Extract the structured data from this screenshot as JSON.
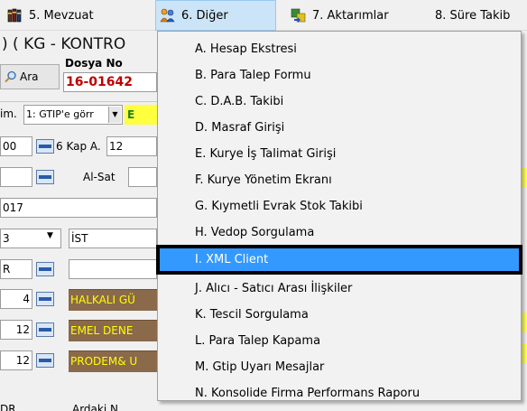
{
  "menubar": {
    "items": [
      {
        "label": "5. Mevzuat"
      },
      {
        "label": "6. Diğer"
      },
      {
        "label": "7. Aktarımlar"
      },
      {
        "label": "8. Süre Takib"
      }
    ]
  },
  "form": {
    "title": ") ( KG - KONTRO",
    "search_button": "Ara",
    "dosya_label": "Dosya No",
    "dosya_value": "16-01642",
    "row1_left": "im.",
    "row1_select": "1: GTIP'e görr",
    "row1_tail": "E",
    "row2_value": "00",
    "kap_label": "6 Kap A.",
    "kap_value": "12",
    "alsat_label": "Al-Sat",
    "row4_value": "017",
    "row5_value": "3",
    "row5_city": "İST",
    "row6_value": "R",
    "list_rows": [
      {
        "qty": "4",
        "name": "HALKALI GÜ"
      },
      {
        "qty": "12",
        "name": "EMEL DENE"
      },
      {
        "qty": "12",
        "name": "PRODEM& U"
      }
    ],
    "bottom_left": "DR",
    "bottom_mid": "Ardaki N"
  },
  "dropdown": {
    "items": [
      {
        "label": "A.  Hesap Ekstresi"
      },
      {
        "label": "B.  Para Talep Formu"
      },
      {
        "label": "C.  D.A.B. Takibi"
      },
      {
        "label": "D.  Masraf Girişi"
      },
      {
        "label": "E.  Kurye İş Talimat Girişi"
      },
      {
        "label": "F.  Kurye Yönetim Ekranı"
      },
      {
        "label": "G.  Kıymetli Evrak Stok Takibi"
      },
      {
        "label": "H.  Vedop Sorgulama"
      },
      {
        "label": "I.   XML Client"
      },
      {
        "label": "J.  Alıcı - Satıcı Arası İlişkiler"
      },
      {
        "label": "K.  Tescil Sorgulama"
      },
      {
        "label": "L. Para Talep Kapama"
      },
      {
        "label": "M. Gtip Uyarı Mesajlar"
      },
      {
        "label": "N. Konsolide Firma Performans Raporu"
      }
    ],
    "highlighted_index": 8
  },
  "colors": {
    "menu_active": "#cce4f7",
    "selection": "#3399ff",
    "dosya_red": "#c00000",
    "yellow_text": "#ffff00"
  }
}
